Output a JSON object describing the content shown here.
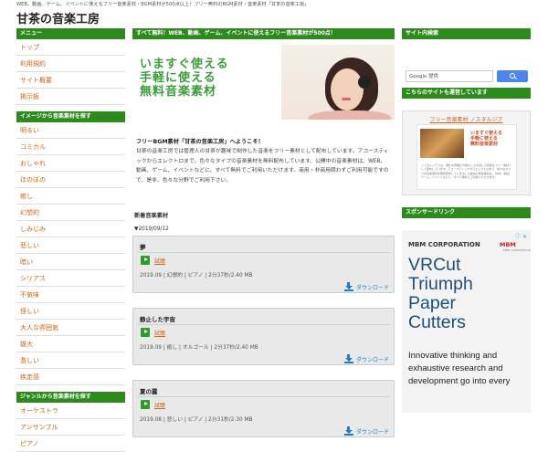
{
  "header": {
    "tagline": "WEB、動画、ゲーム、イベントに使えるフリー音楽素材・BGM素材が500点以上！フリー無料のBGM素材・音楽素材「甘茶の音楽工房」",
    "title": "甘茶の音楽工房"
  },
  "sidebar_left": {
    "menu_title": "メニュー",
    "menu": [
      "トップ",
      "利用規約",
      "サイト概要",
      "掲示板"
    ],
    "image_title": "イメージから音楽素材を探す",
    "image_items": [
      "明るい",
      "コミカル",
      "おしゃれ",
      "ほのぼの",
      "癒し",
      "幻想的",
      "しみじみ",
      "悲しい",
      "暗い",
      "シリアス",
      "不気味",
      "怪しい",
      "大人な雰囲気",
      "雄大",
      "激しい",
      "疾走感"
    ],
    "genre_title": "ジャンルから音楽素材を探す",
    "genre_items": [
      "オーケストラ",
      "アンサンブル",
      "ピアノ"
    ]
  },
  "main": {
    "banner_head": "すべて無料！WEB、動画、ゲーム、イベントに使えるフリー音楽素材が500点！",
    "banner_lines": [
      "いますぐ使える",
      "手軽に使える",
      "無料音楽素材"
    ],
    "intro_title": "フリーBGM素材「甘茶の音楽工房」へようこそ！",
    "intro_text": "甘茶の音楽工房では管理人の甘茶が趣味で制作した音楽をフリー素材として配布しています。アコースティックからエレクトロまで、色々なタイプの音楽素材を無料配布しています。公開中の音楽素材は、WEB、動画、ゲーム、イベントなどに、すべて無料でご利用いただけます。商用・非商用問わずご利用可能ですので、是非、色々な分野でご利用下さい。",
    "new_title": "新着音楽素材",
    "new_date": "▼2019/09/12",
    "tracks": [
      {
        "title": "夢",
        "listen": "試聴",
        "meta": "2019.09 | 幻想的 | ピアノ | 2分37秒/2.40 MB",
        "download": "ダウンロード"
      },
      {
        "title": "静止した宇宙",
        "listen": "試聴",
        "meta": "2019.09 | 癒し | オルゴール | 2分37秒/2.40 MB",
        "download": "ダウンロード"
      },
      {
        "title": "夏の露",
        "listen": "試聴",
        "meta": "2019.08 | 悲しい | ピアノ | 2分31秒/2.30 MB",
        "download": "ダウンロード"
      }
    ]
  },
  "sidebar_right": {
    "search_title": "サイト内検索",
    "search_brand": "Google",
    "search_placeholder": "提供",
    "other_title": "こちらのサイトも運営しています",
    "other_link": "フリー音楽素材 ノスタルジア",
    "other_lines": [
      "いますぐ使える",
      "手軽に使える",
      "無料音楽素材"
    ],
    "other_desc": "ノスタルジアでは、素朴な雰囲気や懐かしさを感じる音楽をフリー素材として配布しています。アコースティックからエレクトロまで、色々なタイプの音楽素材を無料配布しています。公開中の音楽素材は、WEB、動画、ゲーム、イベントなどに、すべて無料でご利用いただけます。",
    "sponsor_title": "スポンサードリンク"
  },
  "ad": {
    "corp": "MBM CORPORATION",
    "logo": "MBM",
    "logo_sub": "MBM CORPORATION",
    "headline_lines": [
      "VRCut",
      "Triumph",
      "Paper",
      "Cutters"
    ],
    "body_lines": [
      "Innovative thinking and",
      "exhaustive research and",
      "development go into every"
    ]
  },
  "icons": {
    "play": "play-icon",
    "download": "download-icon",
    "search": "search-icon",
    "ad_info": "info-icon",
    "ad_close": "close-icon"
  },
  "colors": {
    "section_green": "#2d8a1c",
    "link_orange": "#c36a1b",
    "download_blue": "#1f7ec4",
    "banner_green": "#3a9d3a",
    "search_blue": "#4a87e8"
  }
}
